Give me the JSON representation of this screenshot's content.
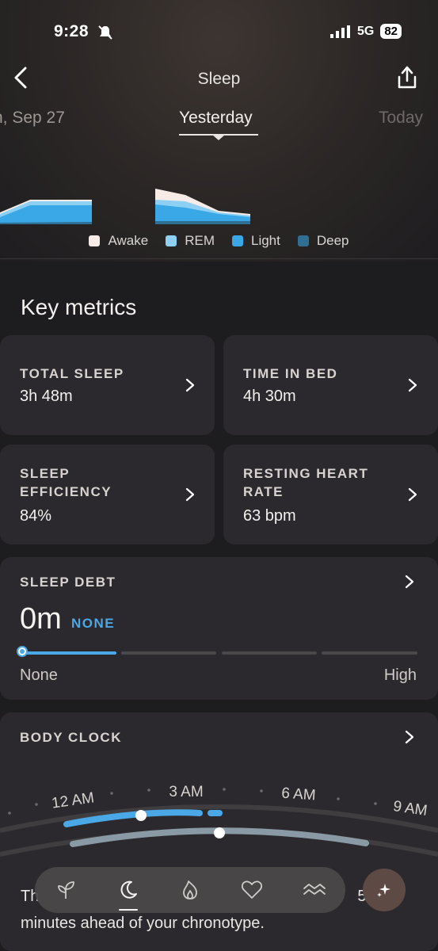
{
  "status_bar": {
    "time": "9:28",
    "signal": "5G",
    "battery": "82"
  },
  "header": {
    "title": "Sleep"
  },
  "date_nav": {
    "previous": "n, Sep 27",
    "current": "Yesterday",
    "next": "Today"
  },
  "legend": [
    {
      "label": "Awake",
      "color": "#f6ebe6"
    },
    {
      "label": "REM",
      "color": "#8dd0f4"
    },
    {
      "label": "Light",
      "color": "#3aa7e6"
    },
    {
      "label": "Deep",
      "color": "#2f6f94"
    }
  ],
  "key_metrics": {
    "title": "Key metrics",
    "total_sleep": {
      "label": "TOTAL SLEEP",
      "value": "3h 48m"
    },
    "time_in_bed": {
      "label": "TIME IN BED",
      "value": "4h 30m"
    },
    "sleep_efficiency": {
      "label_line1": "SLEEP",
      "label_line2": "EFFICIENCY",
      "value": "84%"
    },
    "resting_hr": {
      "label_line1": "RESTING HEART",
      "label_line2": "RATE",
      "value": "63 bpm"
    }
  },
  "sleep_debt": {
    "label": "SLEEP DEBT",
    "value": "0m",
    "level": "NONE",
    "scale_min": "None",
    "scale_max": "High",
    "progress": 0
  },
  "body_clock": {
    "label": "BODY CLOCK",
    "ticks": [
      "12 AM",
      "3 AM",
      "6 AM",
      "9 AM"
    ]
  },
  "insight": {
    "text_start": "Th",
    "text_end": "5",
    "line2": "minutes ahead of your chronotype."
  },
  "nav": {
    "items": [
      "readiness-icon",
      "sleep-icon",
      "activity-icon",
      "heart-icon",
      "stress-icon"
    ],
    "active": "sleep-icon"
  },
  "colors": {
    "accent_blue": "#4aa8e6",
    "card_bg": "#2b292d",
    "page_bg": "#1d1c1f"
  }
}
